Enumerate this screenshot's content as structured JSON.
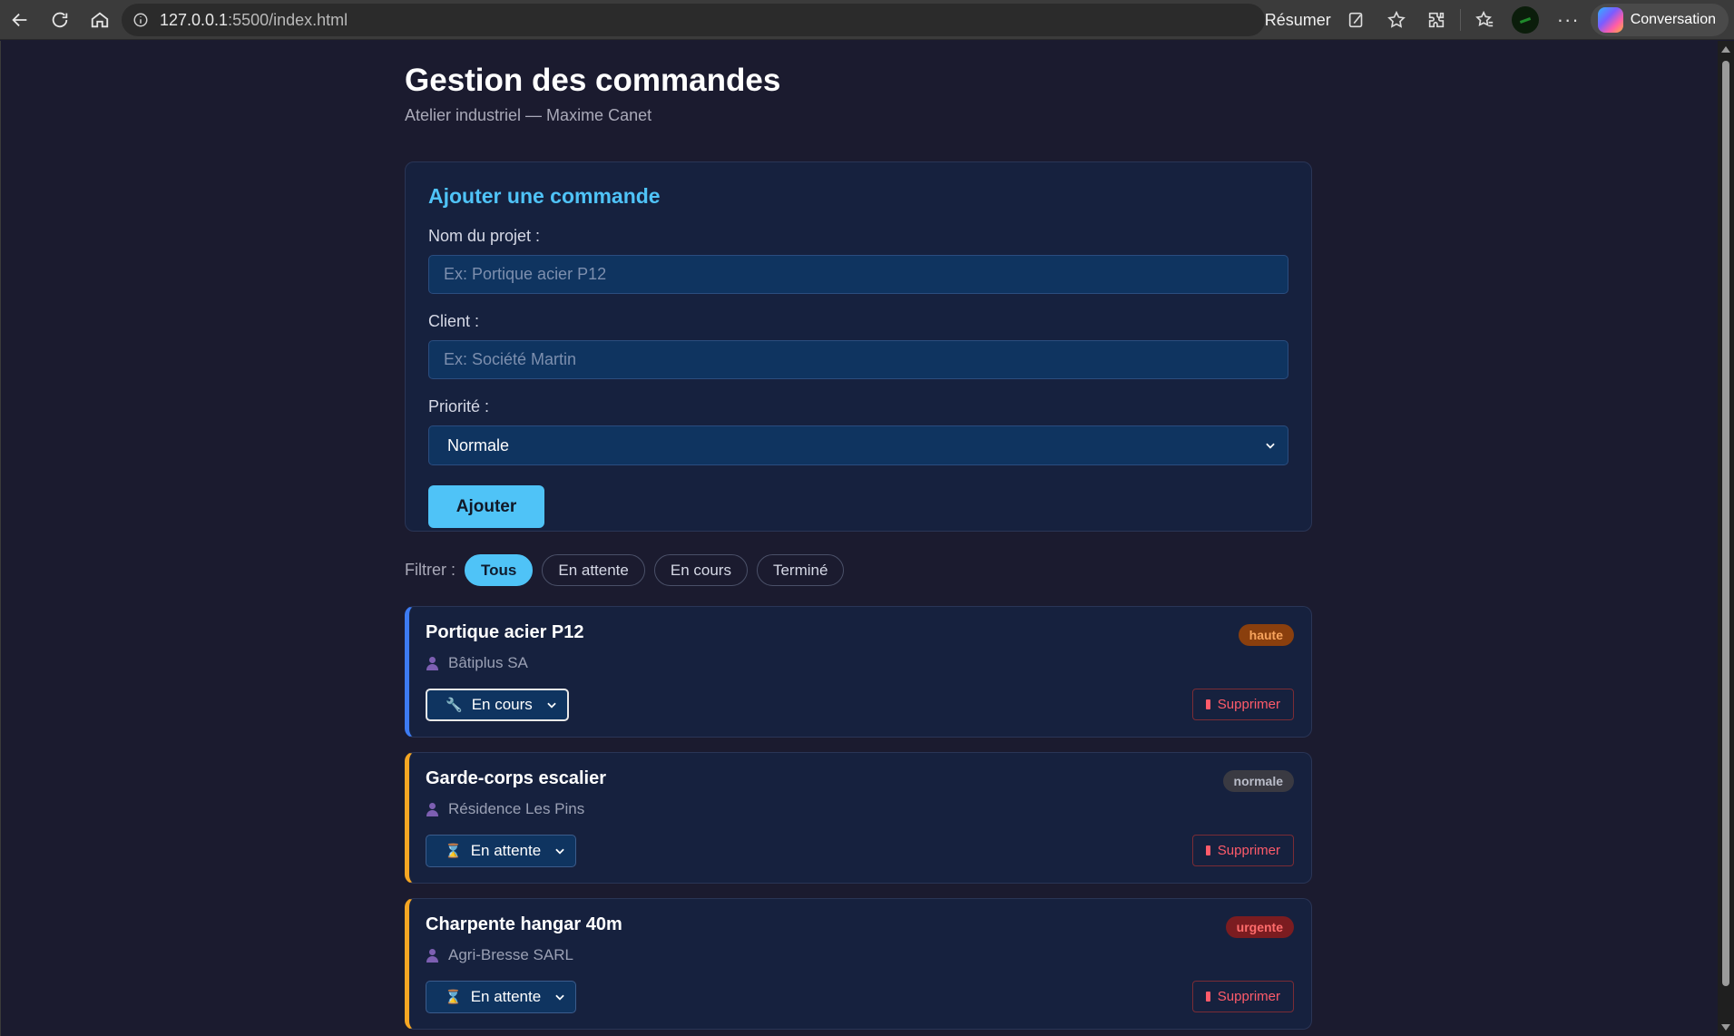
{
  "browser": {
    "url_host": "127.0.0.1",
    "url_path": ":5500/index.html",
    "summarize_label": "Résumer",
    "conversation_label": "Conversation"
  },
  "page": {
    "title": "Gestion des commandes",
    "subtitle": "Atelier industriel — Maxime Canet"
  },
  "form": {
    "heading": "Ajouter une commande",
    "project_label": "Nom du projet :",
    "project_placeholder": "Ex: Portique acier P12",
    "client_label": "Client :",
    "client_placeholder": "Ex: Société Martin",
    "priority_label": "Priorité :",
    "priority_value": "Normale",
    "submit_label": "Ajouter"
  },
  "filters": {
    "label": "Filtrer :",
    "options": [
      "Tous",
      "En attente",
      "En cours",
      "Terminé"
    ],
    "active": "Tous"
  },
  "orders": [
    {
      "name": "Portique acier P12",
      "client": "Bâtiplus SA",
      "status": "En cours",
      "status_icon": "wrench-icon",
      "priority": "haute",
      "delete_label": "Supprimer",
      "accent": "#3d7bf2"
    },
    {
      "name": "Garde-corps escalier",
      "client": "Résidence Les Pins",
      "status": "En attente",
      "status_icon": "hourglass-icon",
      "priority": "normale",
      "delete_label": "Supprimer",
      "accent": "#f5a623"
    },
    {
      "name": "Charpente hangar 40m",
      "client": "Agri-Bresse SARL",
      "status": "En attente",
      "status_icon": "hourglass-icon",
      "priority": "urgente",
      "delete_label": "Supprimer",
      "accent": "#f5a623"
    }
  ],
  "colors": {
    "accent": "#4fc3f7",
    "background": "#1b1b2f",
    "card": "#16213e",
    "input": "#0f3460"
  }
}
